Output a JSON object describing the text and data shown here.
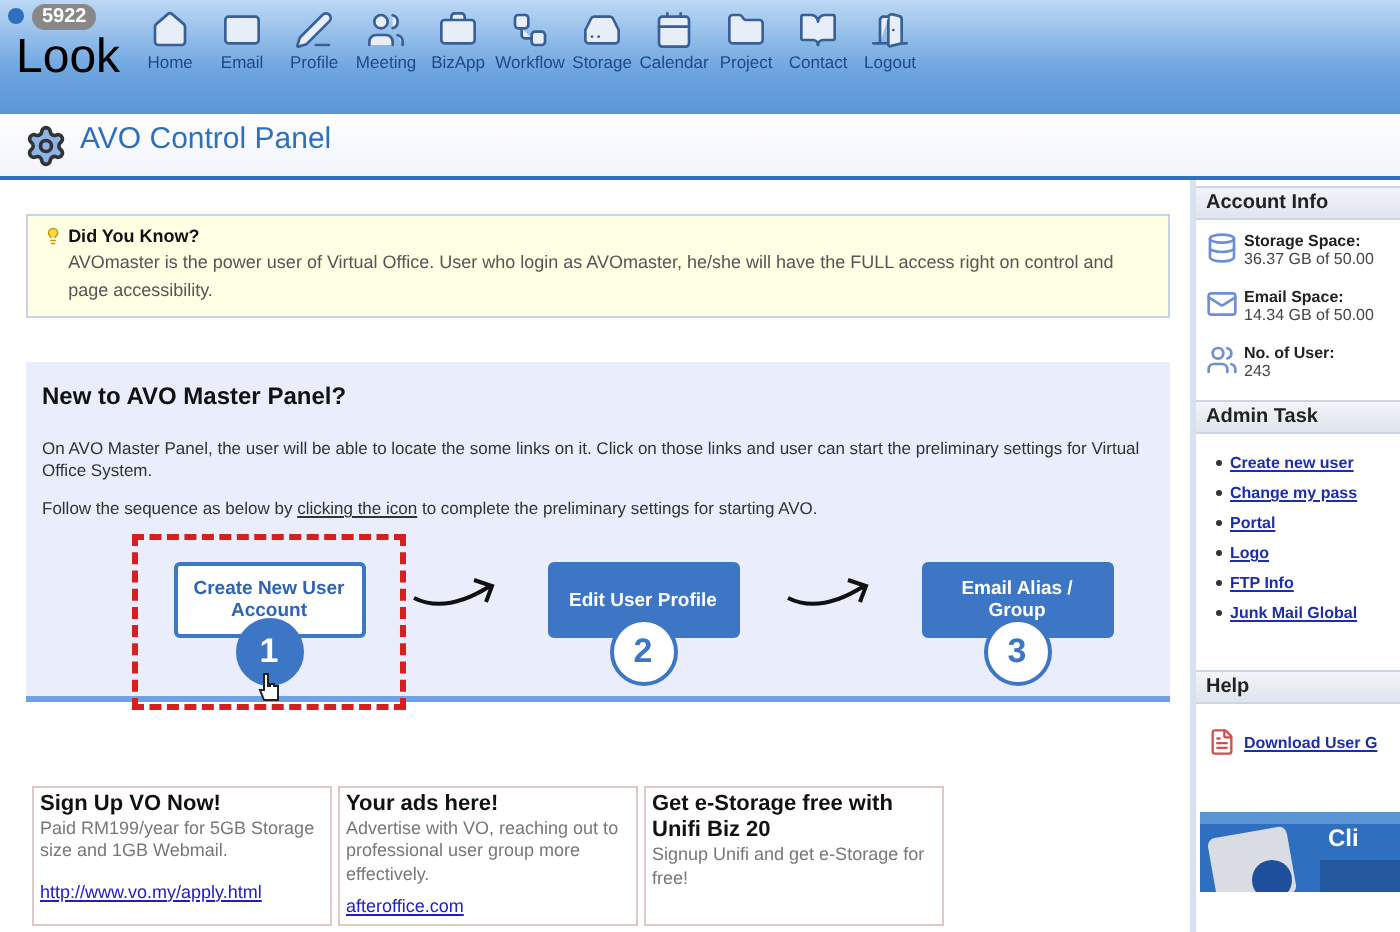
{
  "header": {
    "badge": "5922",
    "brand": "Look"
  },
  "nav": [
    {
      "label": "Home"
    },
    {
      "label": "Email"
    },
    {
      "label": "Profile"
    },
    {
      "label": "Meeting"
    },
    {
      "label": "BizApp"
    },
    {
      "label": "Workflow"
    },
    {
      "label": "Storage"
    },
    {
      "label": "Calendar"
    },
    {
      "label": "Project"
    },
    {
      "label": "Contact"
    },
    {
      "label": "Logout"
    }
  ],
  "page_title": "AVO Control Panel",
  "tip": {
    "title": "Did You Know?",
    "text": "AVOmaster is the power user of Virtual Office. User who login as AVOmaster, he/she will have the FULL access right on control and page accessibility."
  },
  "intro": {
    "title": "New to AVO Master Panel?",
    "text": "On AVO Master Panel, the user will be able to locate the some links on it. Click on those links and user can start the preliminary settings for Virtual Office System.",
    "follow_before": "Follow the sequence as below by",
    "follow_link": "clicking the icon",
    "follow_after": "to complete the preliminary settings for starting AVO.",
    "steps": [
      {
        "label": "Create New User Account",
        "number": "1",
        "selected": true
      },
      {
        "label": "Edit User Profile",
        "number": "2",
        "selected": false
      },
      {
        "label": "Email Alias / Group",
        "number": "3",
        "selected": false
      }
    ]
  },
  "ads": [
    {
      "title": "Sign Up VO Now!",
      "text": "Paid RM199/year for 5GB Storage size and 1GB Webmail.",
      "link": "http://www.vo.my/apply.html"
    },
    {
      "title": "Your ads here!",
      "text": "Advertise with VO, reaching out to professional user group more effectively.",
      "link": "afteroffice.com"
    },
    {
      "title": "Get e-Storage free with Unifi Biz 20",
      "text": "Signup Unifi and get e-Storage for free!"
    }
  ],
  "sidebar": {
    "account": {
      "title": "Account Info",
      "items": [
        {
          "label": "Storage Space:",
          "value": "36.37 GB of 50.00"
        },
        {
          "label": "Email Space:",
          "value": "14.34 GB of 50.00"
        },
        {
          "label": "No. of User:",
          "value": "243"
        }
      ]
    },
    "admin": {
      "title": "Admin Task",
      "links": [
        "Create new user",
        "Change my pass",
        "Portal",
        "Logo",
        "FTP Info",
        "Junk Mail Global"
      ]
    },
    "help": {
      "title": "Help",
      "link": "Download User G"
    },
    "banner": {
      "text": "Cli"
    }
  }
}
